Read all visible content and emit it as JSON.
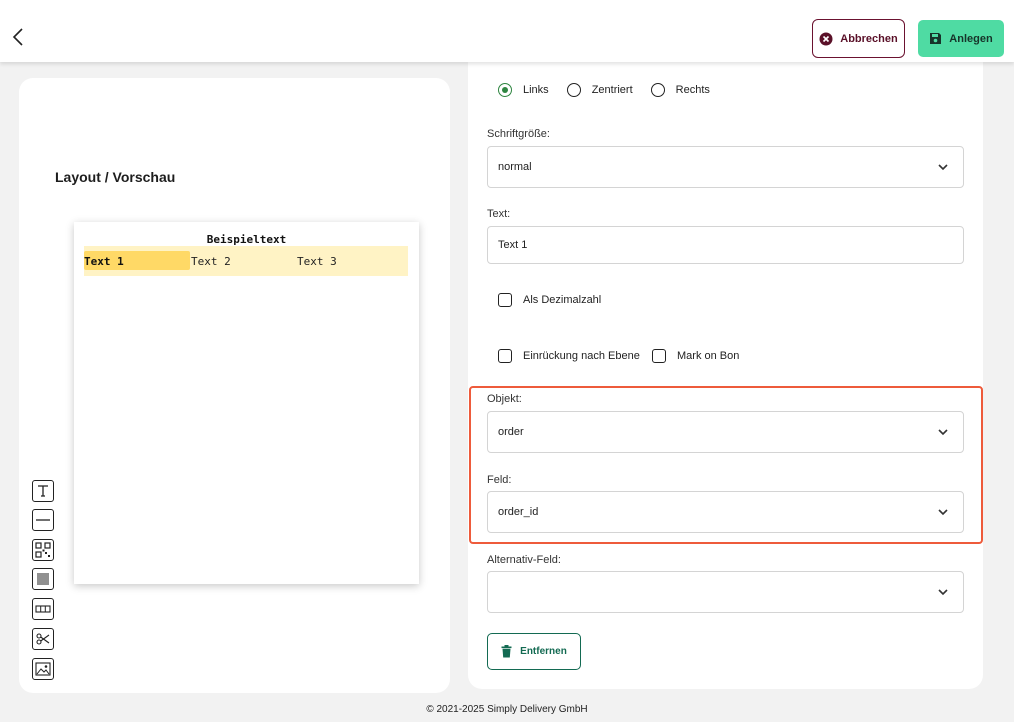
{
  "header": {
    "cancel_label": "Abbrechen",
    "create_label": "Anlegen"
  },
  "preview": {
    "title": "Layout / Vorschau",
    "paper_title": "Beispieltext",
    "row_cells": [
      "Text 1",
      "Text 2",
      "Text 3"
    ]
  },
  "toolbar": {
    "tools": [
      "text-tool",
      "line-tool",
      "qr-code-tool",
      "barcode-tool",
      "columns-tool",
      "cut-tool",
      "image-tool"
    ]
  },
  "form": {
    "alignment": {
      "options": [
        "Links",
        "Zentriert",
        "Rechts"
      ],
      "selected": "Links"
    },
    "font_size": {
      "label": "Schriftgröße:",
      "value": "normal"
    },
    "text": {
      "label": "Text:",
      "value": "Text 1"
    },
    "as_decimal": {
      "label": "Als Dezimalzahl",
      "checked": false
    },
    "indent_by_level": {
      "label": "Einrückung nach Ebene",
      "checked": false
    },
    "mark_on_bon": {
      "label": "Mark on Bon",
      "checked": false
    },
    "object": {
      "label": "Objekt:",
      "value": "order"
    },
    "field": {
      "label": "Feld:",
      "value": "order_id"
    },
    "alt_field": {
      "label": "Alternativ-Feld:",
      "value": ""
    },
    "remove_label": "Entfernen"
  },
  "colors": {
    "cancel_border": "#6b1230",
    "create_bg": "#4fdba3",
    "highlight_border": "#ee5b3b",
    "radio_checked": "#2e8540",
    "remove_border": "#136a52"
  },
  "footer": {
    "copyright": "© 2021-2025 Simply Delivery GmbH"
  }
}
